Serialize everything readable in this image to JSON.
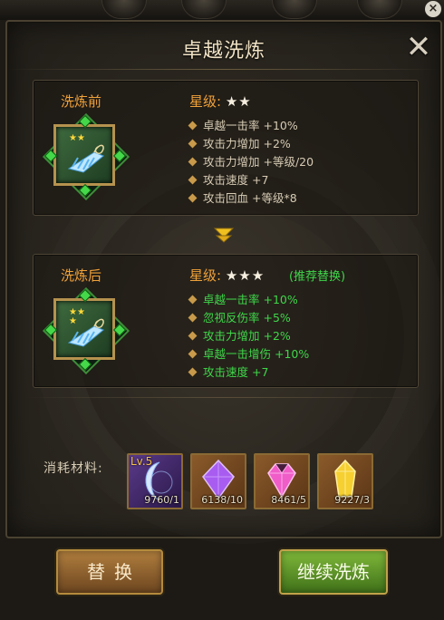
{
  "dialog": {
    "title": "卓越洗炼",
    "close_glyph": "✕"
  },
  "before": {
    "label": "洗炼前",
    "star_label": "星级:",
    "stars": "★★",
    "item_stars": "★★",
    "attributes": [
      "卓越一击率 +10%",
      "攻击力增加 +2%",
      "攻击力增加 +等级/20",
      "攻击速度 +7",
      "攻击回血 +等级*8"
    ]
  },
  "after": {
    "label": "洗炼后",
    "star_label": "星级:",
    "stars": "★★★",
    "recommend": "(推荐替换)",
    "item_stars_top": "★★",
    "item_stars_bottom": "★",
    "attributes": [
      "卓越一击率 +10%",
      "忽视反伤率 +5%",
      "攻击力增加 +2%",
      "卓越一击增伤 +10%",
      "攻击速度 +7"
    ]
  },
  "materials": {
    "label": "消耗材料:",
    "items": [
      {
        "icon": "crescent-moon-icon",
        "level": "Lv.5",
        "count": "9760/1"
      },
      {
        "icon": "purple-crystal-icon",
        "count": "6138/10"
      },
      {
        "icon": "pink-gem-icon",
        "count": "8461/5"
      },
      {
        "icon": "yellow-crystal-icon",
        "count": "9227/3"
      }
    ]
  },
  "buttons": {
    "replace": "替换",
    "continue": "继续洗炼"
  },
  "colors": {
    "accent_orange": "#f0a23a",
    "attr_green": "#3fd64a",
    "gold_border": "#b48a3c"
  }
}
